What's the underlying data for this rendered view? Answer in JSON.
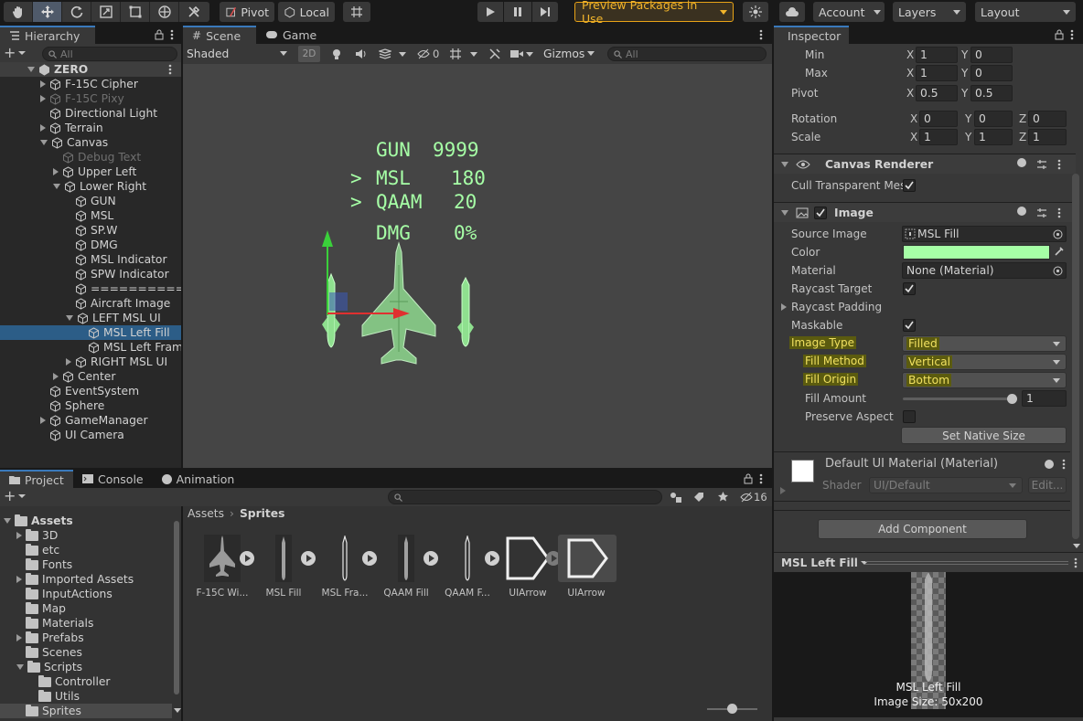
{
  "toolbar": {
    "pivot": "Pivot",
    "local": "Local",
    "preview_packages": "Preview Packages in Use",
    "account": "Account",
    "layers": "Layers",
    "layout": "Layout"
  },
  "hierarchy": {
    "tab": "Hierarchy",
    "search_placeholder": "All",
    "items": [
      {
        "label": "ZERO",
        "depth": 0
      },
      {
        "label": "F-15C Cipher",
        "depth": 1
      },
      {
        "label": "F-15C Pixy",
        "depth": 1
      },
      {
        "label": "Directional Light",
        "depth": 1
      },
      {
        "label": "Terrain",
        "depth": 1
      },
      {
        "label": "Canvas",
        "depth": 1
      },
      {
        "label": "Debug Text",
        "depth": 2
      },
      {
        "label": "Upper Left",
        "depth": 2
      },
      {
        "label": "Lower Right",
        "depth": 2
      },
      {
        "label": "GUN",
        "depth": 3
      },
      {
        "label": "MSL",
        "depth": 3
      },
      {
        "label": "SP.W",
        "depth": 3
      },
      {
        "label": "DMG",
        "depth": 3
      },
      {
        "label": "MSL Indicator",
        "depth": 3
      },
      {
        "label": "SPW Indicator",
        "depth": 3
      },
      {
        "label": "==========",
        "depth": 3
      },
      {
        "label": "Aircraft Image",
        "depth": 3
      },
      {
        "label": "LEFT MSL UI",
        "depth": 3
      },
      {
        "label": "MSL Left Fill",
        "depth": 4
      },
      {
        "label": "MSL Left Fram",
        "depth": 4
      },
      {
        "label": "RIGHT MSL UI",
        "depth": 3
      },
      {
        "label": "Center",
        "depth": 2
      },
      {
        "label": "EventSystem",
        "depth": 1
      },
      {
        "label": "Sphere",
        "depth": 1
      },
      {
        "label": "GameManager",
        "depth": 1
      },
      {
        "label": "UI Camera",
        "depth": 1
      }
    ]
  },
  "scene": {
    "tab_scene": "Scene",
    "tab_game": "Game",
    "shading": "Shaded",
    "mode_2d": "2D",
    "hidden_count": "0",
    "gizmos": "Gizmos",
    "search_placeholder": "All",
    "hud": {
      "gun_label": "GUN",
      "gun_value": "9999",
      "msl_marker": ">",
      "msl_label": "MSL",
      "msl_value": "180",
      "qaam_marker": ">",
      "qaam_label": "QAAM",
      "qaam_value": "20",
      "dmg_label": "DMG",
      "dmg_value": "0%"
    },
    "hud_color": "#a6ffa6"
  },
  "inspector": {
    "tab": "Inspector",
    "anchors": {
      "min_label": "Min",
      "min_x": "1",
      "min_y": "0",
      "max_label": "Max",
      "max_x": "1",
      "max_y": "0"
    },
    "pivot": {
      "label": "Pivot",
      "x": "0.5",
      "y": "0.5"
    },
    "rotation": {
      "label": "Rotation",
      "x": "0",
      "y": "0",
      "z": "0"
    },
    "scale": {
      "label": "Scale",
      "x": "1",
      "y": "1",
      "z": "1"
    },
    "axis_x": "X",
    "axis_y": "Y",
    "axis_z": "Z",
    "canvas_renderer": {
      "title": "Canvas Renderer",
      "cull_label": "Cull Transparent Mes"
    },
    "image": {
      "title": "Image",
      "source_image_label": "Source Image",
      "source_image_value": "MSL Fill",
      "color_label": "Color",
      "color_value": "#a6ffa6",
      "material_label": "Material",
      "material_value": "None (Material)",
      "raycast_target_label": "Raycast Target",
      "raycast_padding_label": "Raycast Padding",
      "maskable_label": "Maskable",
      "image_type_label": "Image Type",
      "image_type_value": "Filled",
      "fill_method_label": "Fill Method",
      "fill_method_value": "Vertical",
      "fill_origin_label": "Fill Origin",
      "fill_origin_value": "Bottom",
      "fill_amount_label": "Fill Amount",
      "fill_amount_value": "1",
      "preserve_aspect_label": "Preserve Aspect",
      "set_native_size": "Set Native Size"
    },
    "material": {
      "title": "Default UI Material (Material)",
      "shader_label": "Shader",
      "shader_value": "UI/Default",
      "edit": "Edit..."
    },
    "add_component": "Add Component",
    "preview": {
      "selector": "MSL Left Fill",
      "name": "MSL Left Fill",
      "size": "Image Size: 50x200"
    }
  },
  "project": {
    "tab_project": "Project",
    "tab_console": "Console",
    "tab_animation": "Animation",
    "hidden_count": "16",
    "breadcrumb_root": "Assets",
    "breadcrumb_current": "Sprites",
    "tree": [
      {
        "label": "Assets",
        "depth": 0
      },
      {
        "label": "3D",
        "depth": 1
      },
      {
        "label": "etc",
        "depth": 1
      },
      {
        "label": "Fonts",
        "depth": 1
      },
      {
        "label": "Imported Assets",
        "depth": 1
      },
      {
        "label": "InputActions",
        "depth": 1
      },
      {
        "label": "Map",
        "depth": 1
      },
      {
        "label": "Materials",
        "depth": 1
      },
      {
        "label": "Prefabs",
        "depth": 1
      },
      {
        "label": "Scenes",
        "depth": 1
      },
      {
        "label": "Scripts",
        "depth": 1
      },
      {
        "label": "Controller",
        "depth": 2
      },
      {
        "label": "Utils",
        "depth": 2
      },
      {
        "label": "Sprites",
        "depth": 1
      }
    ],
    "assets": [
      {
        "label": "F-15C Wi..."
      },
      {
        "label": "MSL Fill"
      },
      {
        "label": "MSL Fra..."
      },
      {
        "label": "QAAM Fill"
      },
      {
        "label": "QAAM F..."
      },
      {
        "label": "UIArrow"
      },
      {
        "label": "UIArrow"
      }
    ]
  }
}
